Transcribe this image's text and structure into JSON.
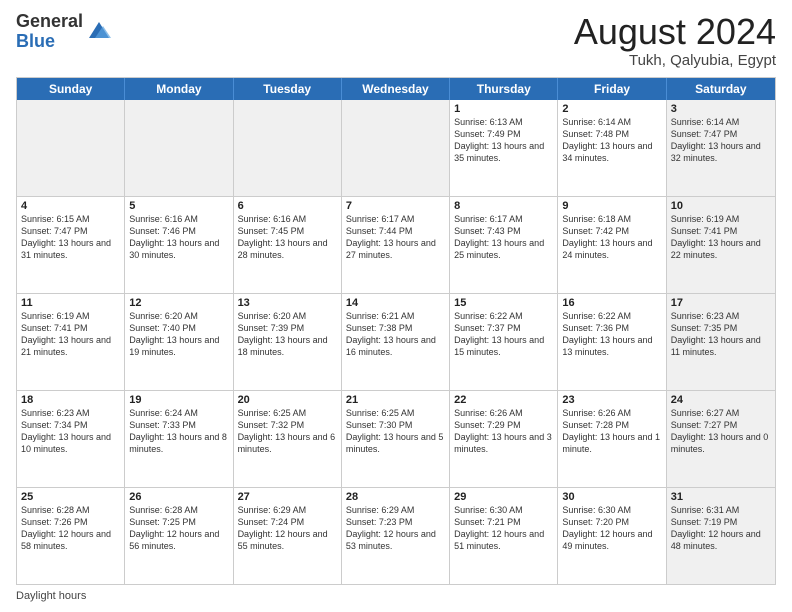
{
  "logo": {
    "general": "General",
    "blue": "Blue"
  },
  "title": "August 2024",
  "subtitle": "Tukh, Qalyubia, Egypt",
  "days": [
    "Sunday",
    "Monday",
    "Tuesday",
    "Wednesday",
    "Thursday",
    "Friday",
    "Saturday"
  ],
  "weeks": [
    [
      {
        "day": "",
        "text": "",
        "shaded": true
      },
      {
        "day": "",
        "text": "",
        "shaded": true
      },
      {
        "day": "",
        "text": "",
        "shaded": true
      },
      {
        "day": "",
        "text": "",
        "shaded": true
      },
      {
        "day": "1",
        "text": "Sunrise: 6:13 AM\nSunset: 7:49 PM\nDaylight: 13 hours and 35 minutes.",
        "shaded": false
      },
      {
        "day": "2",
        "text": "Sunrise: 6:14 AM\nSunset: 7:48 PM\nDaylight: 13 hours and 34 minutes.",
        "shaded": false
      },
      {
        "day": "3",
        "text": "Sunrise: 6:14 AM\nSunset: 7:47 PM\nDaylight: 13 hours and 32 minutes.",
        "shaded": true
      }
    ],
    [
      {
        "day": "4",
        "text": "Sunrise: 6:15 AM\nSunset: 7:47 PM\nDaylight: 13 hours and 31 minutes.",
        "shaded": false
      },
      {
        "day": "5",
        "text": "Sunrise: 6:16 AM\nSunset: 7:46 PM\nDaylight: 13 hours and 30 minutes.",
        "shaded": false
      },
      {
        "day": "6",
        "text": "Sunrise: 6:16 AM\nSunset: 7:45 PM\nDaylight: 13 hours and 28 minutes.",
        "shaded": false
      },
      {
        "day": "7",
        "text": "Sunrise: 6:17 AM\nSunset: 7:44 PM\nDaylight: 13 hours and 27 minutes.",
        "shaded": false
      },
      {
        "day": "8",
        "text": "Sunrise: 6:17 AM\nSunset: 7:43 PM\nDaylight: 13 hours and 25 minutes.",
        "shaded": false
      },
      {
        "day": "9",
        "text": "Sunrise: 6:18 AM\nSunset: 7:42 PM\nDaylight: 13 hours and 24 minutes.",
        "shaded": false
      },
      {
        "day": "10",
        "text": "Sunrise: 6:19 AM\nSunset: 7:41 PM\nDaylight: 13 hours and 22 minutes.",
        "shaded": true
      }
    ],
    [
      {
        "day": "11",
        "text": "Sunrise: 6:19 AM\nSunset: 7:41 PM\nDaylight: 13 hours and 21 minutes.",
        "shaded": false
      },
      {
        "day": "12",
        "text": "Sunrise: 6:20 AM\nSunset: 7:40 PM\nDaylight: 13 hours and 19 minutes.",
        "shaded": false
      },
      {
        "day": "13",
        "text": "Sunrise: 6:20 AM\nSunset: 7:39 PM\nDaylight: 13 hours and 18 minutes.",
        "shaded": false
      },
      {
        "day": "14",
        "text": "Sunrise: 6:21 AM\nSunset: 7:38 PM\nDaylight: 13 hours and 16 minutes.",
        "shaded": false
      },
      {
        "day": "15",
        "text": "Sunrise: 6:22 AM\nSunset: 7:37 PM\nDaylight: 13 hours and 15 minutes.",
        "shaded": false
      },
      {
        "day": "16",
        "text": "Sunrise: 6:22 AM\nSunset: 7:36 PM\nDaylight: 13 hours and 13 minutes.",
        "shaded": false
      },
      {
        "day": "17",
        "text": "Sunrise: 6:23 AM\nSunset: 7:35 PM\nDaylight: 13 hours and 11 minutes.",
        "shaded": true
      }
    ],
    [
      {
        "day": "18",
        "text": "Sunrise: 6:23 AM\nSunset: 7:34 PM\nDaylight: 13 hours and 10 minutes.",
        "shaded": false
      },
      {
        "day": "19",
        "text": "Sunrise: 6:24 AM\nSunset: 7:33 PM\nDaylight: 13 hours and 8 minutes.",
        "shaded": false
      },
      {
        "day": "20",
        "text": "Sunrise: 6:25 AM\nSunset: 7:32 PM\nDaylight: 13 hours and 6 minutes.",
        "shaded": false
      },
      {
        "day": "21",
        "text": "Sunrise: 6:25 AM\nSunset: 7:30 PM\nDaylight: 13 hours and 5 minutes.",
        "shaded": false
      },
      {
        "day": "22",
        "text": "Sunrise: 6:26 AM\nSunset: 7:29 PM\nDaylight: 13 hours and 3 minutes.",
        "shaded": false
      },
      {
        "day": "23",
        "text": "Sunrise: 6:26 AM\nSunset: 7:28 PM\nDaylight: 13 hours and 1 minute.",
        "shaded": false
      },
      {
        "day": "24",
        "text": "Sunrise: 6:27 AM\nSunset: 7:27 PM\nDaylight: 13 hours and 0 minutes.",
        "shaded": true
      }
    ],
    [
      {
        "day": "25",
        "text": "Sunrise: 6:28 AM\nSunset: 7:26 PM\nDaylight: 12 hours and 58 minutes.",
        "shaded": false
      },
      {
        "day": "26",
        "text": "Sunrise: 6:28 AM\nSunset: 7:25 PM\nDaylight: 12 hours and 56 minutes.",
        "shaded": false
      },
      {
        "day": "27",
        "text": "Sunrise: 6:29 AM\nSunset: 7:24 PM\nDaylight: 12 hours and 55 minutes.",
        "shaded": false
      },
      {
        "day": "28",
        "text": "Sunrise: 6:29 AM\nSunset: 7:23 PM\nDaylight: 12 hours and 53 minutes.",
        "shaded": false
      },
      {
        "day": "29",
        "text": "Sunrise: 6:30 AM\nSunset: 7:21 PM\nDaylight: 12 hours and 51 minutes.",
        "shaded": false
      },
      {
        "day": "30",
        "text": "Sunrise: 6:30 AM\nSunset: 7:20 PM\nDaylight: 12 hours and 49 minutes.",
        "shaded": false
      },
      {
        "day": "31",
        "text": "Sunrise: 6:31 AM\nSunset: 7:19 PM\nDaylight: 12 hours and 48 minutes.",
        "shaded": true
      }
    ]
  ],
  "footer": "Daylight hours"
}
